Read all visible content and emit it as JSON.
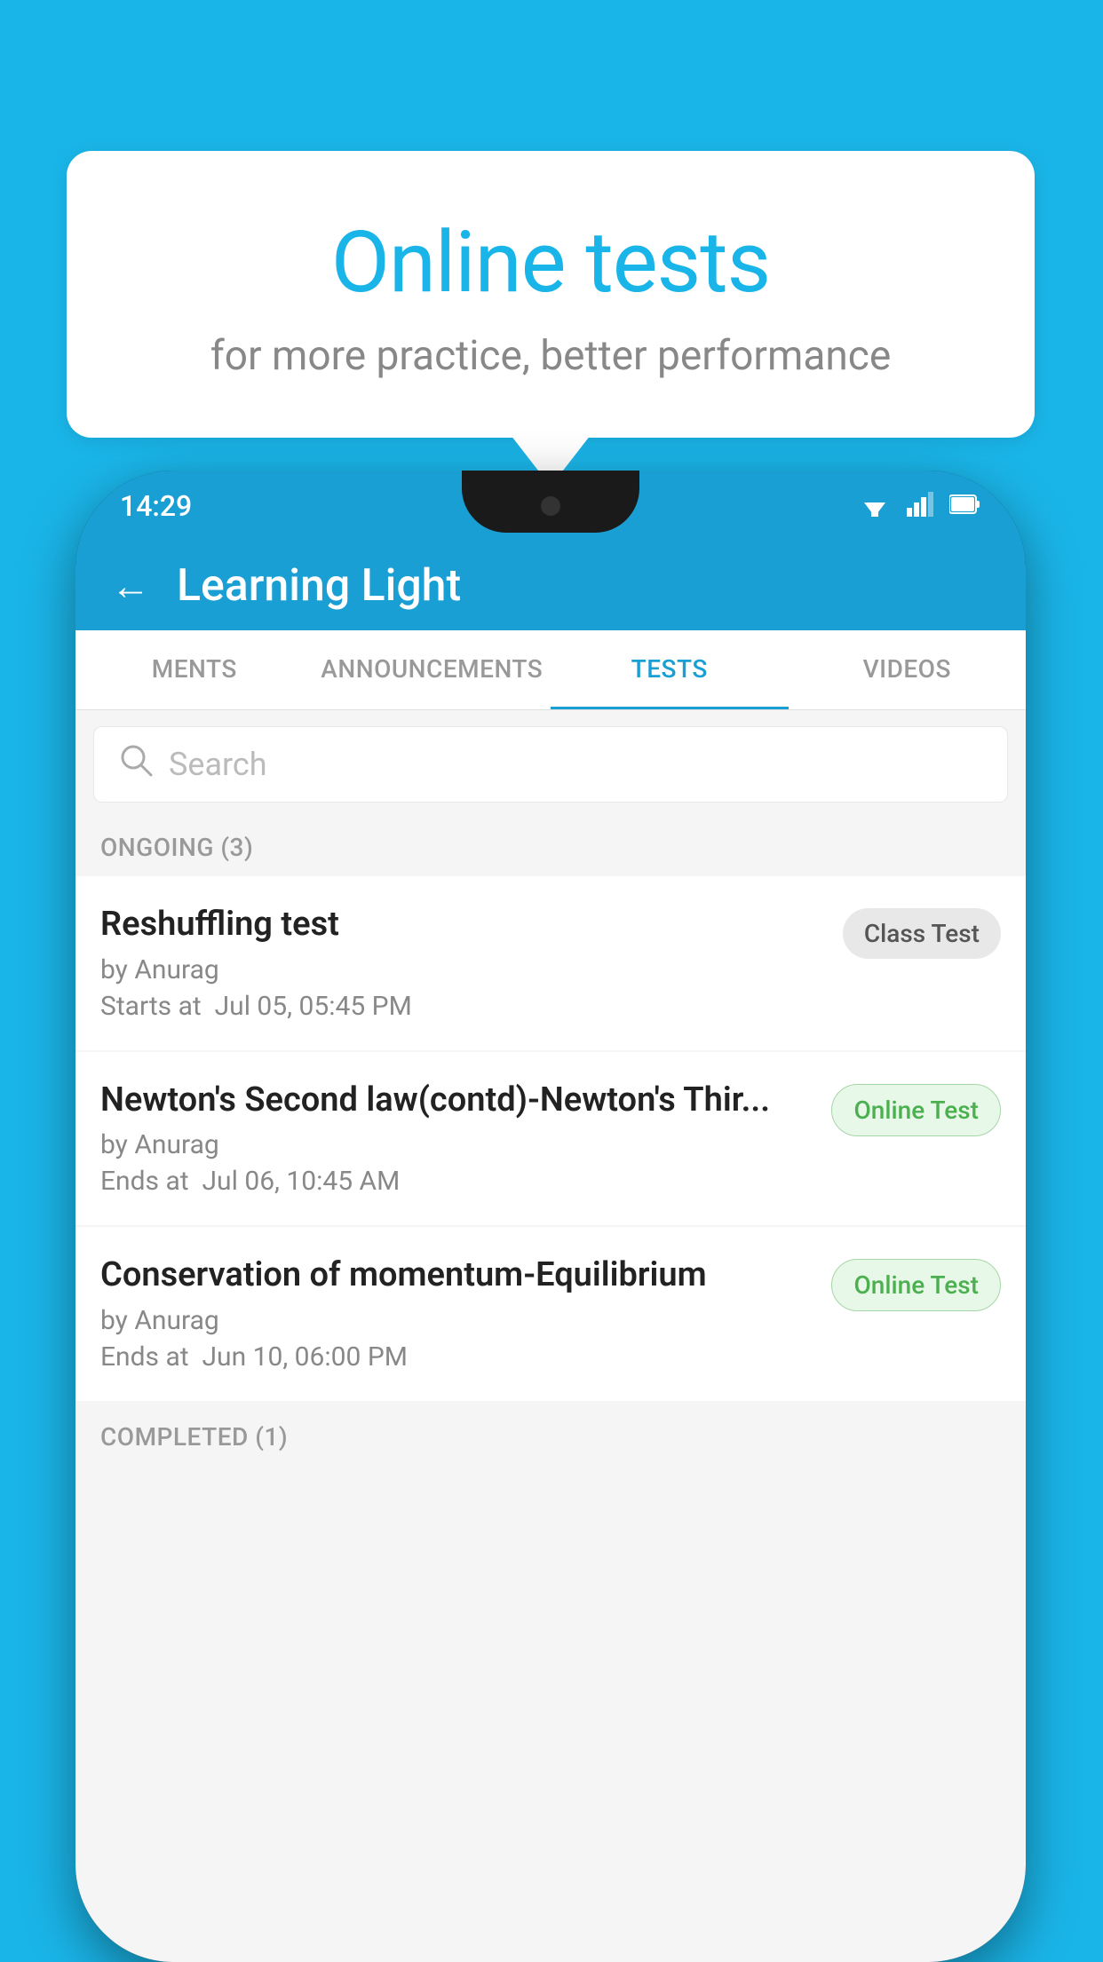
{
  "background": {
    "color": "#1ab5e8"
  },
  "speech_bubble": {
    "title": "Online tests",
    "subtitle": "for more practice, better performance"
  },
  "phone": {
    "status_bar": {
      "time": "14:29",
      "wifi_icon": "▾",
      "signal_icon": "▴",
      "battery_icon": "▮"
    },
    "app_header": {
      "back_label": "←",
      "title": "Learning Light"
    },
    "tabs": [
      {
        "label": "MENTS",
        "active": false
      },
      {
        "label": "ANNOUNCEMENTS",
        "active": false
      },
      {
        "label": "TESTS",
        "active": true
      },
      {
        "label": "VIDEOS",
        "active": false
      }
    ],
    "search": {
      "placeholder": "Search",
      "icon": "🔍"
    },
    "ongoing_section": {
      "label": "ONGOING (3)",
      "items": [
        {
          "name": "Reshuffling test",
          "author": "by Anurag",
          "date_label": "Starts at",
          "date": "Jul 05, 05:45 PM",
          "badge": "Class Test",
          "badge_type": "class"
        },
        {
          "name": "Newton's Second law(contd)-Newton's Thir...",
          "author": "by Anurag",
          "date_label": "Ends at",
          "date": "Jul 06, 10:45 AM",
          "badge": "Online Test",
          "badge_type": "online"
        },
        {
          "name": "Conservation of momentum-Equilibrium",
          "author": "by Anurag",
          "date_label": "Ends at",
          "date": "Jun 10, 06:00 PM",
          "badge": "Online Test",
          "badge_type": "online"
        }
      ]
    },
    "completed_section": {
      "label": "COMPLETED (1)"
    }
  }
}
